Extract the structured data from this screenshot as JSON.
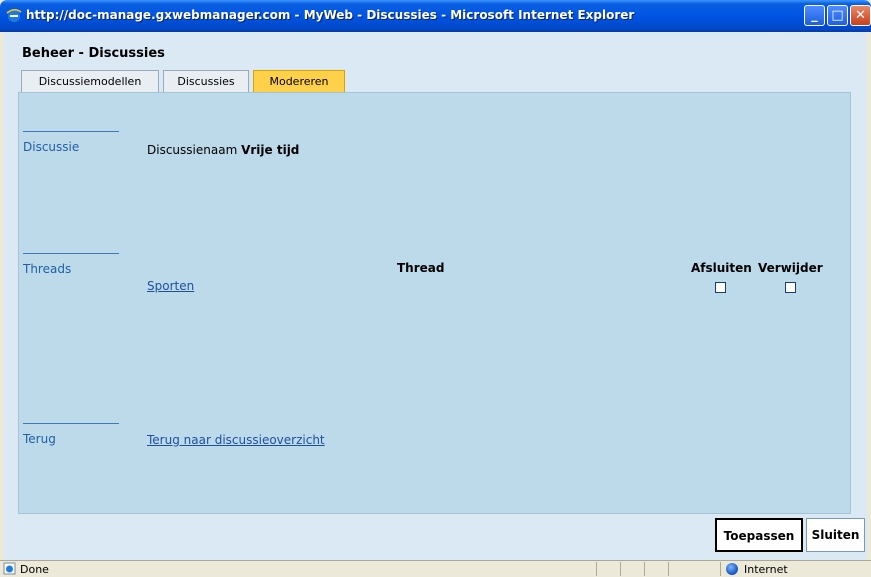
{
  "window": {
    "title": "http://doc-manage.gxwebmanager.com - MyWeb - Discussies - Microsoft Internet Explorer",
    "minimize": "_",
    "maximize": "□",
    "close": "✕"
  },
  "page": {
    "heading": "Beheer - Discussies"
  },
  "tabs": [
    {
      "label": "Discussiemodellen",
      "active": false
    },
    {
      "label": "Discussies",
      "active": false
    },
    {
      "label": "Modereren",
      "active": true
    }
  ],
  "sections": {
    "discussie": {
      "label": "Discussie",
      "name_label": "Discussienaam",
      "name_value": "Vrije tijd"
    },
    "threads": {
      "label": "Threads",
      "column_thread": "Thread",
      "column_close": "Afsluiten",
      "column_delete": "Verwijder",
      "rows": [
        {
          "name": "Sporten",
          "close_checked": false,
          "delete_checked": false
        }
      ]
    },
    "terug": {
      "label": "Terug",
      "link": "Terug naar discussieoverzicht"
    }
  },
  "buttons": {
    "apply": "Toepassen",
    "close": "Sluiten"
  },
  "statusbar": {
    "status": "Done",
    "zone": "Internet"
  },
  "colors": {
    "titlebar": "#0054e3",
    "tab_active": "#ffd04a",
    "panel": "#bddaeb",
    "link": "#1f4fa0"
  }
}
